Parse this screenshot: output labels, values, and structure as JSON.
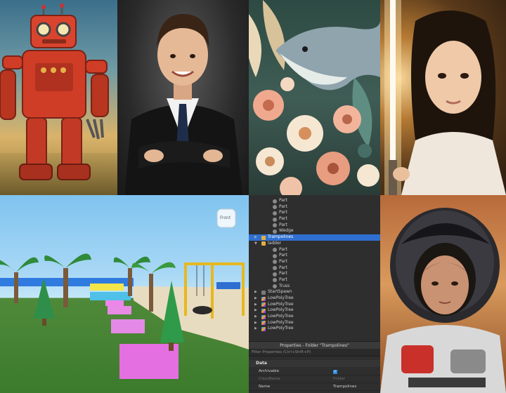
{
  "explorer": {
    "rows": [
      {
        "label": "Part",
        "icon": "part"
      },
      {
        "label": "Part",
        "icon": "part"
      },
      {
        "label": "Part",
        "icon": "part"
      },
      {
        "label": "Part",
        "icon": "part"
      },
      {
        "label": "Part",
        "icon": "part"
      },
      {
        "label": "Wedge",
        "icon": "wedge"
      },
      {
        "label": "Trampolines",
        "icon": "folder",
        "selected": true
      },
      {
        "label": "ladder",
        "icon": "folder",
        "expanded": true
      },
      {
        "label": "Part",
        "icon": "part"
      },
      {
        "label": "Part",
        "icon": "part"
      },
      {
        "label": "Part",
        "icon": "part"
      },
      {
        "label": "Part",
        "icon": "part"
      },
      {
        "label": "Part",
        "icon": "part"
      },
      {
        "label": "Part",
        "icon": "part"
      },
      {
        "label": "Truss",
        "icon": "truss"
      },
      {
        "label": "StartSpawn",
        "icon": "spawn"
      },
      {
        "label": "LowPolyTree",
        "icon": "model"
      },
      {
        "label": "LowPolyTree",
        "icon": "model"
      },
      {
        "label": "LowPolyTree",
        "icon": "model"
      },
      {
        "label": "LowPolyTree",
        "icon": "model"
      },
      {
        "label": "LowPolyTree",
        "icon": "model"
      },
      {
        "label": "LowPolyTree",
        "icon": "model"
      }
    ]
  },
  "properties": {
    "header": "Properties - Folder \"Trampolines\"",
    "filter_placeholder": "Filter Properties (Ctrl+Shift+P)",
    "section": "Data",
    "rows": [
      {
        "name": "Archivable",
        "value": "",
        "checkbox": true
      },
      {
        "name": "ClassName",
        "value": "Folder",
        "dim": true
      },
      {
        "name": "Name",
        "value": "Trampolines"
      }
    ]
  },
  "viewport": {
    "view_cube_label": "Front"
  },
  "colors": {
    "selection": "#2f6fd1",
    "panel_bg": "#2e2e2e",
    "trampoline_pink": "#e46fe0"
  }
}
